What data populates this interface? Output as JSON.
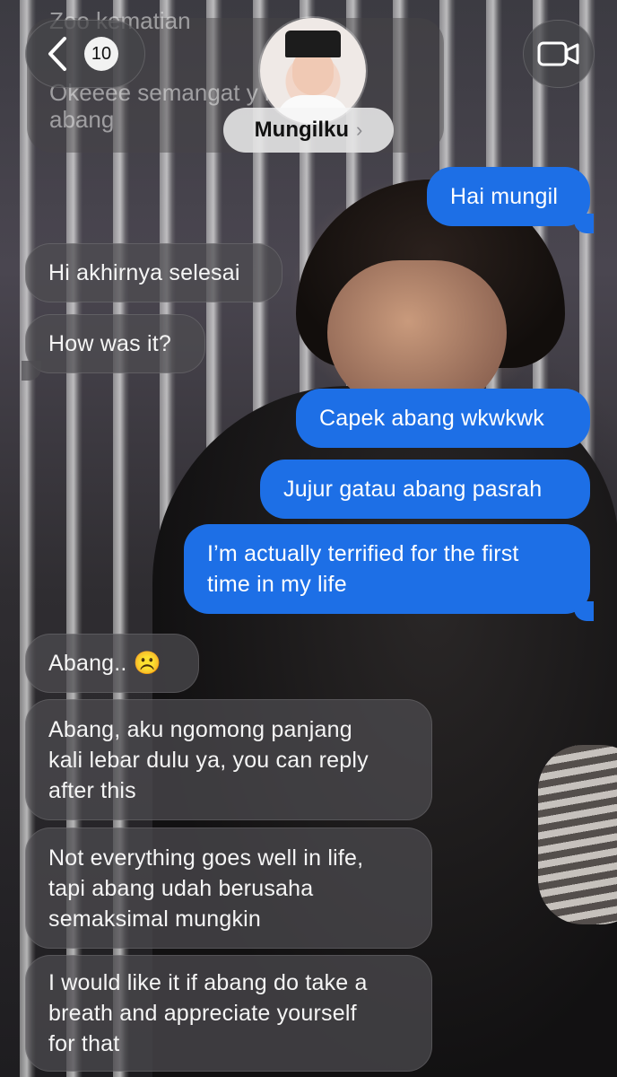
{
  "header": {
    "unread_count": "10",
    "contact_name": "Mungilku",
    "previous_preview_lines": [
      "Zoo kematian",
      "Okeeee semangat y love you",
      "abang"
    ]
  },
  "messages": [
    {
      "side": "sent",
      "text": "Hai mungil"
    },
    {
      "side": "recv",
      "text": "Hi akhirnya selesai"
    },
    {
      "side": "recv",
      "text": "How was it?"
    },
    {
      "side": "sent",
      "text": "Capek abang wkwkwk"
    },
    {
      "side": "sent",
      "text": "Jujur gatau abang pasrah"
    },
    {
      "side": "sent",
      "lines": [
        "I’m actually terrified for the first",
        "time in my life"
      ]
    },
    {
      "side": "recv",
      "text": "Abang.. ☹️"
    },
    {
      "side": "recv",
      "lines": [
        "Abang, aku ngomong panjang",
        "kali lebar dulu ya, you can reply",
        "after this"
      ]
    },
    {
      "side": "recv",
      "lines": [
        "Not everything goes well in life,",
        "tapi abang udah berusaha",
        "semaksimal mungkin"
      ]
    },
    {
      "side": "recv",
      "lines": [
        "I would like it if abang do take a",
        "breath and appreciate yourself",
        "for that"
      ]
    }
  ],
  "colors": {
    "sent_bubble": "#1d6fe6",
    "recv_bubble": "#4e4c50"
  },
  "icons": {
    "back": "chevron-left-icon",
    "video": "video-camera-icon",
    "contact_chevron": "chevron-right-icon"
  }
}
